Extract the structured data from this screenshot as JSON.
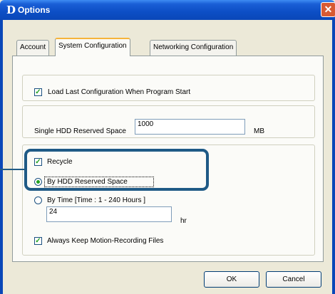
{
  "window": {
    "title": "Options",
    "app_icon_glyph": "D",
    "close_glyph": "✕"
  },
  "tabs": [
    {
      "label": "Account",
      "active": false
    },
    {
      "label": "System Configuration",
      "active": true
    },
    {
      "label": "Networking Configuration",
      "active": false
    }
  ],
  "load_last_config": {
    "label": "Load Last Configuration When Program Start",
    "checked": true
  },
  "hdd_reserved": {
    "label": "Single HDD Reserved Space",
    "value": "1000",
    "unit": "MB"
  },
  "recycle": {
    "label": "Recycle",
    "checked": true
  },
  "by_hdd_reserved": {
    "label": "By HDD Reserved Space",
    "selected": true
  },
  "by_time": {
    "label": "By Time [Time : 1 - 240 Hours ]",
    "value": "24",
    "unit": "hr",
    "selected": false
  },
  "keep_motion": {
    "label": "Always Keep Motion-Recording Files",
    "checked": true
  },
  "buttons": {
    "ok": "OK",
    "cancel": "Cancel"
  },
  "colors": {
    "titlebar": "#0c4ec5",
    "dialog_bg": "#ece9d8",
    "highlight": "#1f5a86",
    "check": "#21a121"
  }
}
